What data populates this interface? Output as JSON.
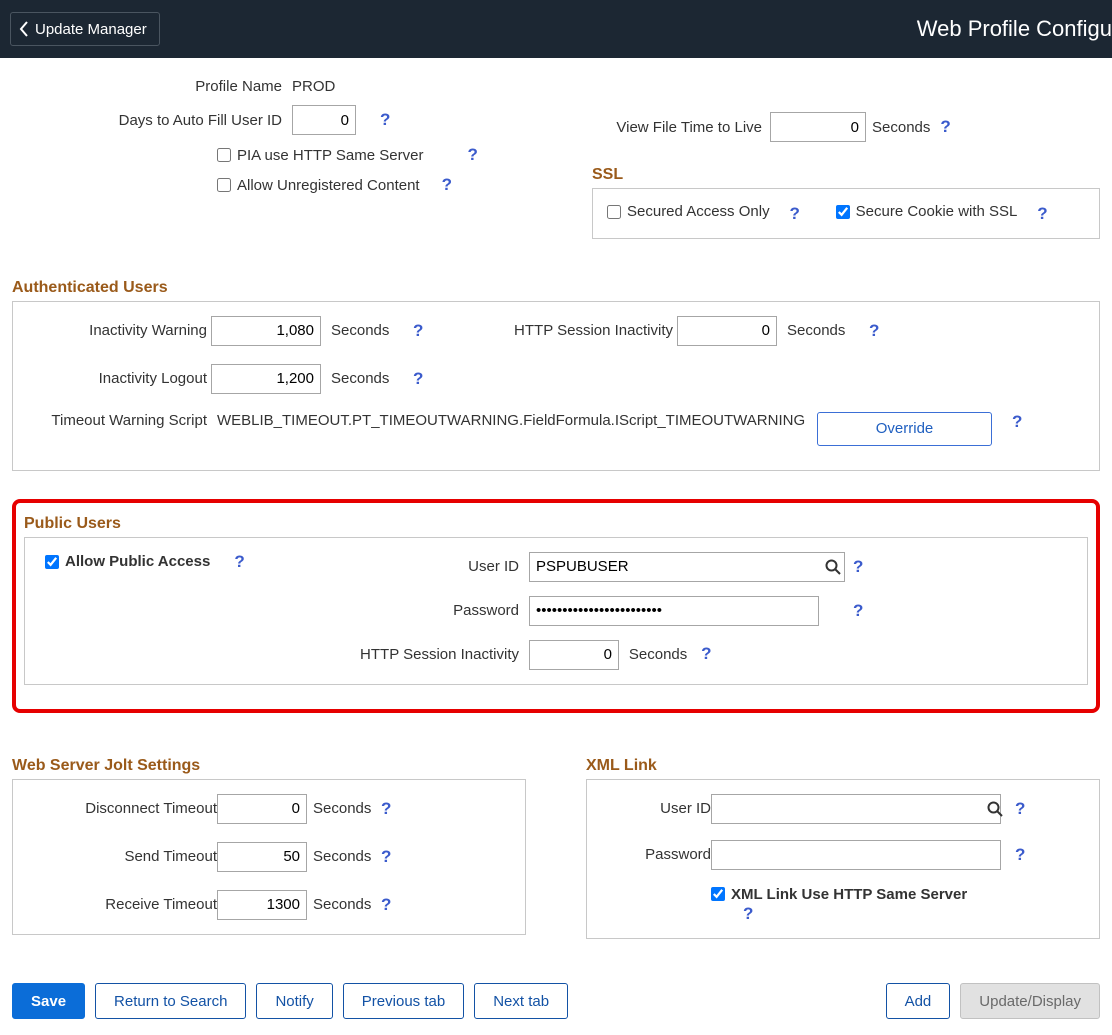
{
  "topbar": {
    "back": "Update Manager",
    "title": "Web Profile Configu"
  },
  "header": {
    "profile_name_label": "Profile Name",
    "profile_name_value": "PROD",
    "days_autofill_label": "Days to Auto Fill User ID",
    "days_autofill_value": "0",
    "viewfile_label": "View File Time to Live",
    "viewfile_value": "0",
    "seconds": "Seconds",
    "pia_same_server": "PIA use HTTP Same Server",
    "allow_unreg": "Allow Unregistered Content"
  },
  "ssl": {
    "title": "SSL",
    "secured_only": "Secured Access Only",
    "secure_cookie": "Secure Cookie with SSL"
  },
  "auth": {
    "title": "Authenticated Users",
    "inactivity_warning_label": "Inactivity Warning",
    "inactivity_warning_value": "1,080",
    "inactivity_logout_label": "Inactivity Logout",
    "inactivity_logout_value": "1,200",
    "http_inactivity_label": "HTTP Session Inactivity",
    "http_inactivity_value": "0",
    "timeout_script_label": "Timeout Warning Script",
    "timeout_script_value": "WEBLIB_TIMEOUT.PT_TIMEOUTWARNING.FieldFormula.IScript_TIMEOUTWARNING",
    "override": "Override",
    "seconds": "Seconds"
  },
  "public": {
    "title": "Public Users",
    "allow_public": "Allow Public Access",
    "user_id_label": "User ID",
    "user_id_value": "PSPUBUSER",
    "password_label": "Password",
    "password_value": "••••••••••••••••••••••••",
    "http_inactivity_label": "HTTP Session Inactivity",
    "http_inactivity_value": "0",
    "seconds": "Seconds"
  },
  "jolt": {
    "title": "Web Server Jolt Settings",
    "disconnect_label": "Disconnect Timeout",
    "disconnect_value": "0",
    "send_label": "Send Timeout",
    "send_value": "50",
    "receive_label": "Receive Timeout",
    "receive_value": "1300",
    "seconds": "Seconds"
  },
  "xml": {
    "title": "XML Link",
    "user_id_label": "User ID",
    "user_id_value": "",
    "password_label": "Password",
    "password_value": "",
    "same_server": "XML Link Use HTTP Same Server"
  },
  "footer": {
    "save": "Save",
    "return": "Return to Search",
    "notify": "Notify",
    "prev": "Previous tab",
    "next": "Next tab",
    "add": "Add",
    "update": "Update/Display"
  }
}
